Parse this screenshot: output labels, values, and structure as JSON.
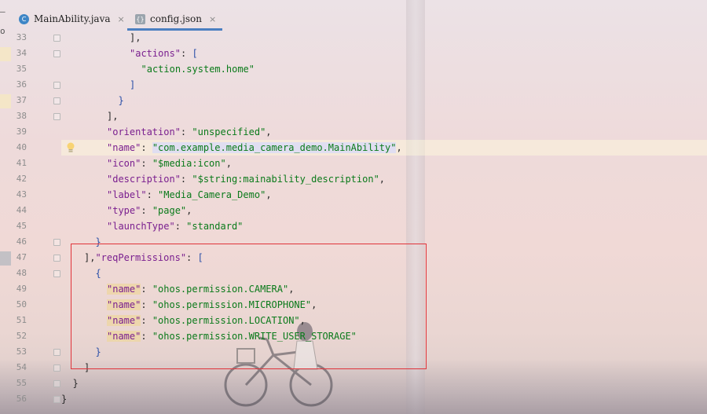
{
  "tabs": [
    {
      "label": "MainAbility.java",
      "icon": "C",
      "close": "×",
      "active": false
    },
    {
      "label": "config.json",
      "icon": "{}",
      "close": "×",
      "active": true
    }
  ],
  "side_edge": {
    "top": "–",
    "second": "o"
  },
  "editor": {
    "lines": [
      {
        "num": "33",
        "indent": 12,
        "tokens": [
          {
            "t": "],",
            "c": "p"
          }
        ]
      },
      {
        "num": "34",
        "indent": 12,
        "tokens": [
          {
            "t": "\"actions\"",
            "c": "k"
          },
          {
            "t": ": ",
            "c": "p"
          },
          {
            "t": "[",
            "c": "b"
          }
        ]
      },
      {
        "num": "35",
        "indent": 14,
        "tokens": [
          {
            "t": "\"action.system.home\"",
            "c": "s"
          }
        ]
      },
      {
        "num": "36",
        "indent": 12,
        "tokens": [
          {
            "t": "]",
            "c": "b"
          }
        ]
      },
      {
        "num": "37",
        "indent": 10,
        "tokens": [
          {
            "t": "}",
            "c": "b"
          }
        ]
      },
      {
        "num": "38",
        "indent": 8,
        "tokens": [
          {
            "t": "],",
            "c": "p"
          }
        ]
      },
      {
        "num": "39",
        "indent": 8,
        "tokens": [
          {
            "t": "\"orientation\"",
            "c": "k"
          },
          {
            "t": ": ",
            "c": "p"
          },
          {
            "t": "\"unspecified\"",
            "c": "s"
          },
          {
            "t": ",",
            "c": "p"
          }
        ]
      },
      {
        "num": "40",
        "indent": 8,
        "highlight": true,
        "bulb": true,
        "tokens": [
          {
            "t": "\"name\"",
            "c": "k"
          },
          {
            "t": ": ",
            "c": "p"
          },
          {
            "t": "\"com.example.media_camera_demo.MainAbility\"",
            "c": "s emph"
          },
          {
            "t": ",",
            "c": "p"
          }
        ]
      },
      {
        "num": "41",
        "indent": 8,
        "tokens": [
          {
            "t": "\"icon\"",
            "c": "k"
          },
          {
            "t": ": ",
            "c": "p"
          },
          {
            "t": "\"$media:icon\"",
            "c": "s"
          },
          {
            "t": ",",
            "c": "p"
          }
        ]
      },
      {
        "num": "42",
        "indent": 8,
        "tokens": [
          {
            "t": "\"description\"",
            "c": "k"
          },
          {
            "t": ": ",
            "c": "p"
          },
          {
            "t": "\"$string:mainability_description\"",
            "c": "s"
          },
          {
            "t": ",",
            "c": "p"
          }
        ]
      },
      {
        "num": "43",
        "indent": 8,
        "tokens": [
          {
            "t": "\"label\"",
            "c": "k"
          },
          {
            "t": ": ",
            "c": "p"
          },
          {
            "t": "\"Media_Camera_Demo\"",
            "c": "s"
          },
          {
            "t": ",",
            "c": "p"
          }
        ]
      },
      {
        "num": "44",
        "indent": 8,
        "tokens": [
          {
            "t": "\"type\"",
            "c": "k"
          },
          {
            "t": ": ",
            "c": "p"
          },
          {
            "t": "\"page\"",
            "c": "s"
          },
          {
            "t": ",",
            "c": "p"
          }
        ]
      },
      {
        "num": "45",
        "indent": 8,
        "tokens": [
          {
            "t": "\"launchType\"",
            "c": "k"
          },
          {
            "t": ": ",
            "c": "p"
          },
          {
            "t": "\"standard\"",
            "c": "s"
          }
        ]
      },
      {
        "num": "46",
        "indent": 6,
        "tokens": [
          {
            "t": "}",
            "c": "b"
          }
        ]
      },
      {
        "num": "47",
        "indent": 4,
        "tokens": [
          {
            "t": "],",
            "c": "p"
          },
          {
            "t": "\"reqPermissions\"",
            "c": "k"
          },
          {
            "t": ": ",
            "c": "p"
          },
          {
            "t": "[",
            "c": "b"
          }
        ]
      },
      {
        "num": "48",
        "indent": 6,
        "tokens": [
          {
            "t": "{",
            "c": "b"
          }
        ]
      },
      {
        "num": "49",
        "indent": 8,
        "tokens": [
          {
            "t": "\"name\"",
            "c": "k emph"
          },
          {
            "t": ": ",
            "c": "p"
          },
          {
            "t": "\"ohos.permission.CAMERA\"",
            "c": "s"
          },
          {
            "t": ",",
            "c": "p"
          }
        ]
      },
      {
        "num": "50",
        "indent": 8,
        "tokens": [
          {
            "t": "\"name\"",
            "c": "k emph"
          },
          {
            "t": ": ",
            "c": "p"
          },
          {
            "t": "\"ohos.permission.MICROPHONE\"",
            "c": "s"
          },
          {
            "t": ",",
            "c": "p"
          }
        ]
      },
      {
        "num": "51",
        "indent": 8,
        "tokens": [
          {
            "t": "\"name\"",
            "c": "k emph"
          },
          {
            "t": ": ",
            "c": "p"
          },
          {
            "t": "\"ohos.permission.LOCATION\"",
            "c": "s"
          },
          {
            "t": ",",
            "c": "p"
          }
        ]
      },
      {
        "num": "52",
        "indent": 8,
        "tokens": [
          {
            "t": "\"name\"",
            "c": "k emph"
          },
          {
            "t": ": ",
            "c": "p"
          },
          {
            "t": "\"ohos.permission.WRITE_USER_STORAGE\"",
            "c": "s"
          }
        ]
      },
      {
        "num": "53",
        "indent": 6,
        "tokens": [
          {
            "t": "}",
            "c": "b"
          }
        ]
      },
      {
        "num": "54",
        "indent": 4,
        "tokens": [
          {
            "t": "]",
            "c": "p"
          }
        ]
      },
      {
        "num": "55",
        "indent": 2,
        "tokens": [
          {
            "t": "}",
            "c": "p"
          }
        ]
      },
      {
        "num": "56",
        "indent": 0,
        "tokens": [
          {
            "t": "}",
            "c": "p"
          }
        ]
      }
    ]
  },
  "colors": {
    "keyword": "#7a1f8f",
    "string": "#0a7a1a",
    "bracket": "#2a4fa8",
    "selection_box": "#e0333a",
    "tab_underline": "#4b7fc1"
  },
  "icons": {
    "java_file": "java-class-icon",
    "json_file": "json-file-icon",
    "intention": "lightbulb-icon",
    "fold": "fold-marker-icon"
  }
}
